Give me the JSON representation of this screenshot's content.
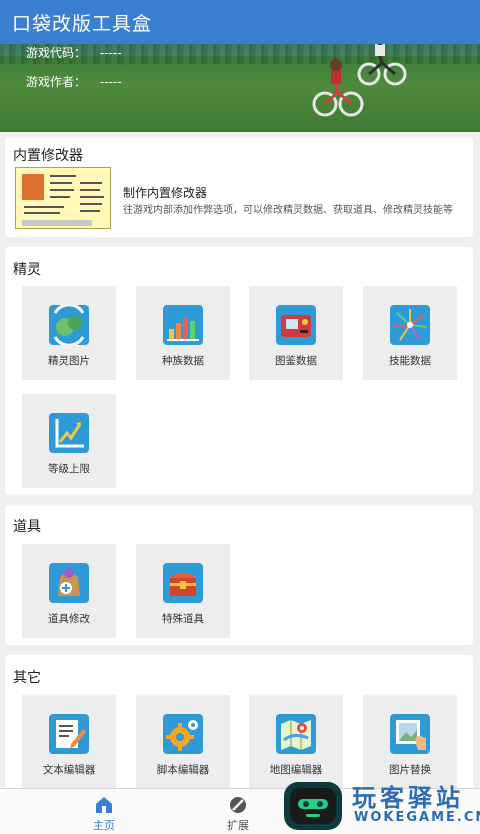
{
  "app": {
    "title": "口袋改版工具盒"
  },
  "game_info": {
    "code_label": "游戏代码：",
    "code_value": "-----",
    "author_label": "游戏作者：",
    "author_value": "-----"
  },
  "builtin": {
    "title": "内置修改器",
    "name": "制作内置修改器",
    "desc": "往游戏内部添加作弊选项，可以修改精灵数据、获取道具、修改精灵技能等"
  },
  "sections": [
    {
      "title": "精灵",
      "items": [
        {
          "label": "精灵图片",
          "icon": "pokemon-sprite-icon"
        },
        {
          "label": "种族数据",
          "icon": "bar-stats-icon"
        },
        {
          "label": "图鉴数据",
          "icon": "pokedex-icon"
        },
        {
          "label": "技能数据",
          "icon": "sparkle-burst-icon"
        },
        {
          "label": "等级上限",
          "icon": "level-chart-icon"
        }
      ]
    },
    {
      "title": "道具",
      "items": [
        {
          "label": "道具修改",
          "icon": "potion-bag-icon"
        },
        {
          "label": "特殊道具",
          "icon": "treasure-chest-icon"
        }
      ]
    },
    {
      "title": "其它",
      "items": [
        {
          "label": "文本编辑器",
          "icon": "text-editor-icon"
        },
        {
          "label": "脚本编辑器",
          "icon": "gear-script-icon"
        },
        {
          "label": "地图编辑器",
          "icon": "map-editor-icon"
        },
        {
          "label": "图片替换",
          "icon": "image-replace-icon"
        }
      ]
    }
  ],
  "tabs": [
    {
      "label": "主页",
      "icon": "home-icon",
      "active": true
    },
    {
      "label": "扩展",
      "icon": "extension-icon",
      "active": false
    }
  ],
  "watermark": {
    "cn": "玩客驿站",
    "en": "WOKEGAME.CN"
  },
  "colors": {
    "primary": "#3b7fd0",
    "tile_bg": "#ededed",
    "icon_bg": "#2e9bd6"
  }
}
